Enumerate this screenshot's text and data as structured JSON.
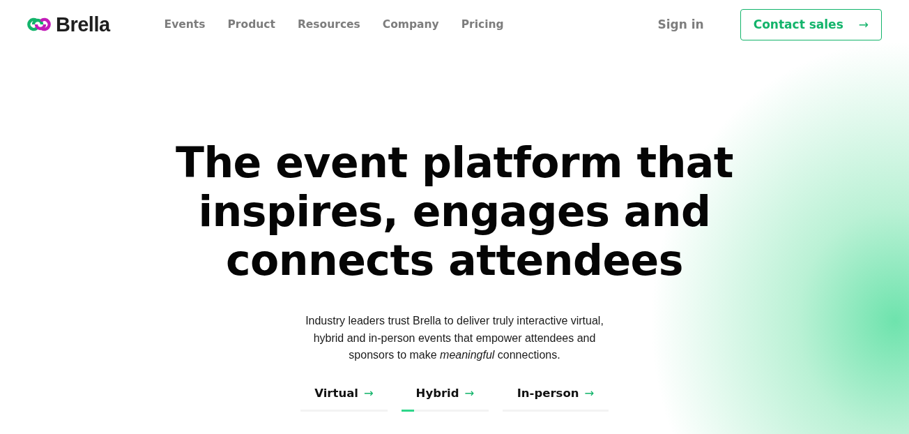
{
  "header": {
    "brand": "Brella",
    "nav": [
      "Events",
      "Product",
      "Resources",
      "Company",
      "Pricing"
    ],
    "sign_in": "Sign in",
    "contact": {
      "label": "Contact sales",
      "arrow": "→"
    }
  },
  "hero": {
    "headline": [
      "The event platform that",
      "inspires, engages and",
      "connects attendees"
    ],
    "description": "Industry leaders trust Brella to deliver truly interactive virtual, hybrid and in-person events that empower attendees and sponsors to make *meaningful* connections.",
    "tabs": [
      {
        "label": "Virtual",
        "arrow": "→"
      },
      {
        "label": "Hybrid",
        "arrow": "→",
        "level": 0.14
      },
      {
        "label": "In-person",
        "arrow": "→"
      }
    ]
  }
}
